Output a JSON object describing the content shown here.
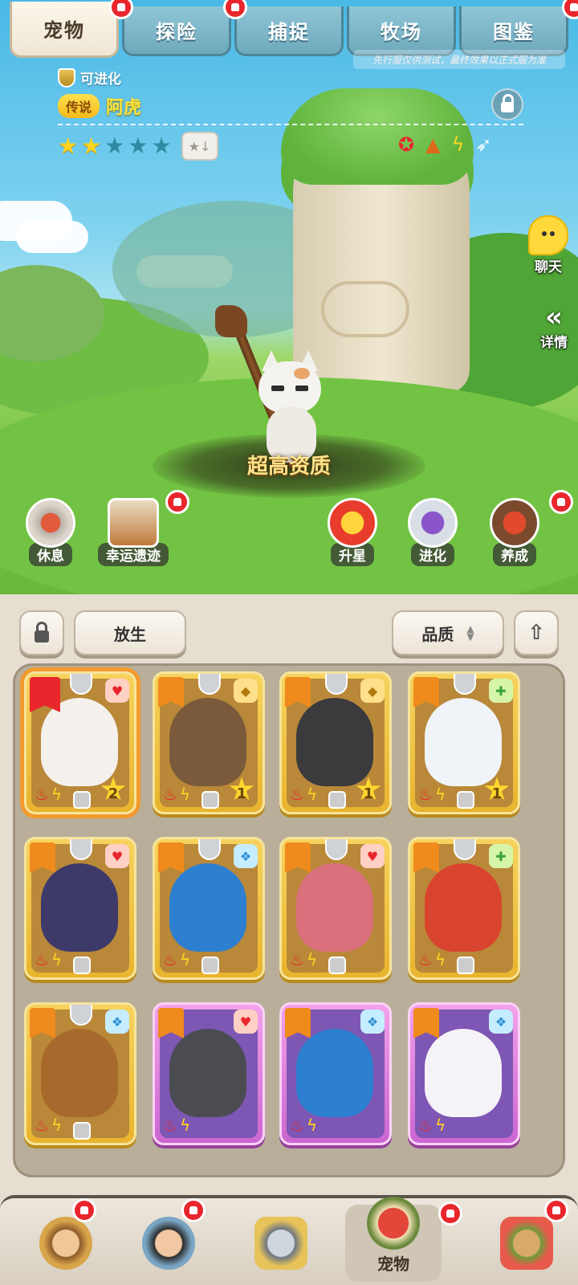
{
  "tabs": [
    {
      "label": "宠物",
      "active": true
    },
    {
      "label": "探险",
      "active": false
    },
    {
      "label": "捕捉",
      "active": false
    },
    {
      "label": "牧场",
      "active": false
    },
    {
      "label": "图鉴",
      "active": false
    }
  ],
  "notice": "先行服仅供测试，最终效果以正式服为准",
  "pet": {
    "evolve_status": "可进化",
    "rarity": "传说",
    "name": "阿虎",
    "stars_filled": 2,
    "stars_total": 5,
    "quality_text": "超高资质",
    "attributes": [
      "fire-claw-icon",
      "mountain-icon",
      "lightning-icon",
      "wing-icon"
    ]
  },
  "side": {
    "chat": "聊天",
    "detail": "详情"
  },
  "actions": [
    {
      "label": "休息",
      "icon": "sleeping-pet-icon"
    },
    {
      "label": "幸运遗迹",
      "icon": "ruins-icon"
    },
    {
      "label": "升星",
      "icon": "star-up-icon"
    },
    {
      "label": "进化",
      "icon": "evolve-icon"
    },
    {
      "label": "养成",
      "icon": "nurture-icon"
    }
  ],
  "toolbar": {
    "release": "放生",
    "sort": "品质"
  },
  "cards": [
    {
      "frame": "gold",
      "element": "fire-paw",
      "level": "2",
      "selected": true,
      "portrait": "white cat"
    },
    {
      "frame": "gold",
      "element": "earth",
      "level": "1",
      "selected": false,
      "portrait": "rock dragon"
    },
    {
      "frame": "gold",
      "element": "earth",
      "level": "1",
      "selected": false,
      "portrait": "black red dragon"
    },
    {
      "frame": "gold",
      "element": "nature",
      "level": "1",
      "selected": false,
      "portrait": "polar bear"
    },
    {
      "frame": "gold",
      "element": "fire-paw",
      "level": "",
      "selected": false,
      "portrait": "dark dragon"
    },
    {
      "frame": "gold",
      "element": "water",
      "level": "",
      "selected": false,
      "portrait": "blue dragon"
    },
    {
      "frame": "gold",
      "element": "fire-paw",
      "level": "",
      "selected": false,
      "portrait": "pink dragon"
    },
    {
      "frame": "gold",
      "element": "nature",
      "level": "",
      "selected": false,
      "portrait": "boar"
    },
    {
      "frame": "gold",
      "element": "water",
      "level": "",
      "selected": false,
      "portrait": "beaver"
    },
    {
      "frame": "purple",
      "element": "fire-paw",
      "level": "",
      "selected": false,
      "portrait": "wolf"
    },
    {
      "frame": "purple",
      "element": "water",
      "level": "",
      "selected": false,
      "portrait": "blue dragon"
    },
    {
      "frame": "purple",
      "element": "water",
      "level": "",
      "selected": false,
      "portrait": "white fluff"
    }
  ],
  "nav": [
    {
      "label": "",
      "icon": "caveman-icon"
    },
    {
      "label": "",
      "icon": "hero-icon"
    },
    {
      "label": "",
      "icon": "battle-icon"
    },
    {
      "label": "宠物",
      "icon": "pet-icon"
    },
    {
      "label": "",
      "icon": "village-icon"
    }
  ],
  "colors": {
    "accent_red": "#e8262c",
    "gold_card": "#f7d35e",
    "purple_card": "#f2a1ea"
  }
}
